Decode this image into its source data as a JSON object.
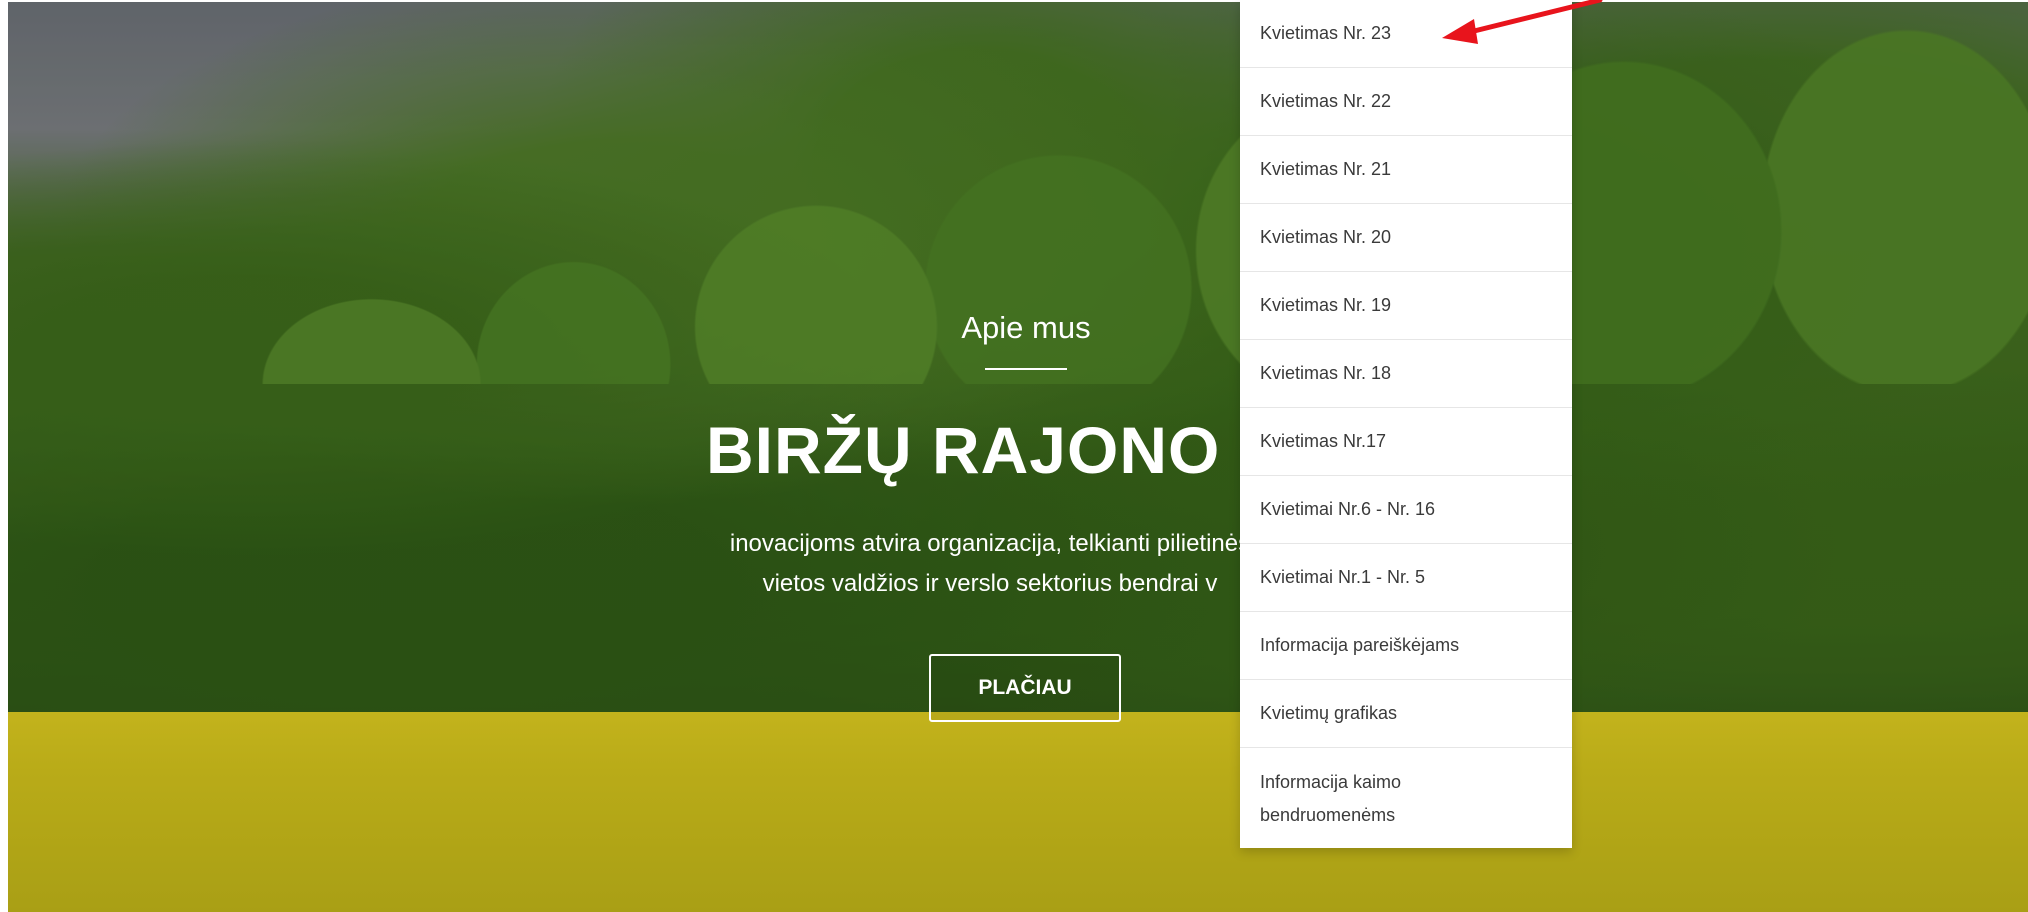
{
  "hero": {
    "eyebrow": "Apie mus",
    "headline": "BIRŽŲ RAJONO V",
    "subtext_line1": "inovacijoms atvira organizacija, telkianti pilietinės",
    "subtext_line2": "vietos valdžios ir verslo sektorius bendrai v",
    "cta_label": "PLAČIAU"
  },
  "dropdown": {
    "items": [
      {
        "label": "Kvietimas Nr. 23"
      },
      {
        "label": "Kvietimas Nr. 22"
      },
      {
        "label": "Kvietimas Nr. 21"
      },
      {
        "label": "Kvietimas Nr. 20"
      },
      {
        "label": "Kvietimas Nr. 19"
      },
      {
        "label": "Kvietimas Nr. 18"
      },
      {
        "label": "Kvietimas Nr.17"
      },
      {
        "label": "Kvietimai Nr.6 - Nr. 16"
      },
      {
        "label": "Kvietimai Nr.1 - Nr. 5"
      },
      {
        "label": "Informacija pareiškėjams"
      },
      {
        "label": "Kvietimų grafikas"
      },
      {
        "label": "Informacija kaimo bendruomenėms"
      }
    ]
  },
  "annotation": {
    "arrow_color": "#e8141c",
    "arrow_icon": "arrow-left-icon"
  }
}
